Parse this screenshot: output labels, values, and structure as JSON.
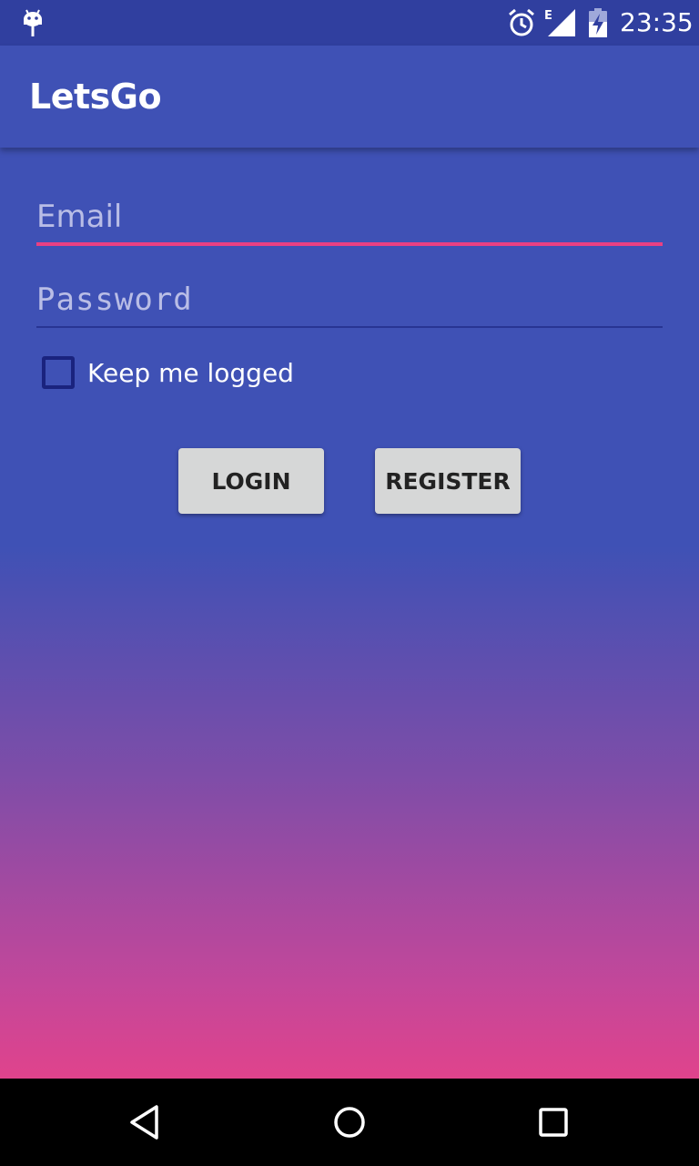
{
  "status_bar": {
    "time": "23:35",
    "network_label": "E",
    "icons": [
      "android-debug-icon",
      "alarm-icon",
      "signal-icon",
      "battery-charging-icon"
    ]
  },
  "app_bar": {
    "title": "LetsGo"
  },
  "login_form": {
    "email_placeholder": "Email",
    "email_value": "",
    "password_placeholder": "Password",
    "password_value": "",
    "keep_logged_label": "Keep me logged",
    "keep_logged_checked": false,
    "login_label": "LOGIN",
    "register_label": "REGISTER"
  },
  "nav_bar": {
    "icons": [
      "back-icon",
      "home-icon",
      "recents-icon"
    ]
  },
  "colors": {
    "primary": "#3f51b5",
    "primary_dark": "#303f9f",
    "accent": "#e94083",
    "gradient_end": "#e0438c",
    "button_bg": "#d6d7d7"
  }
}
